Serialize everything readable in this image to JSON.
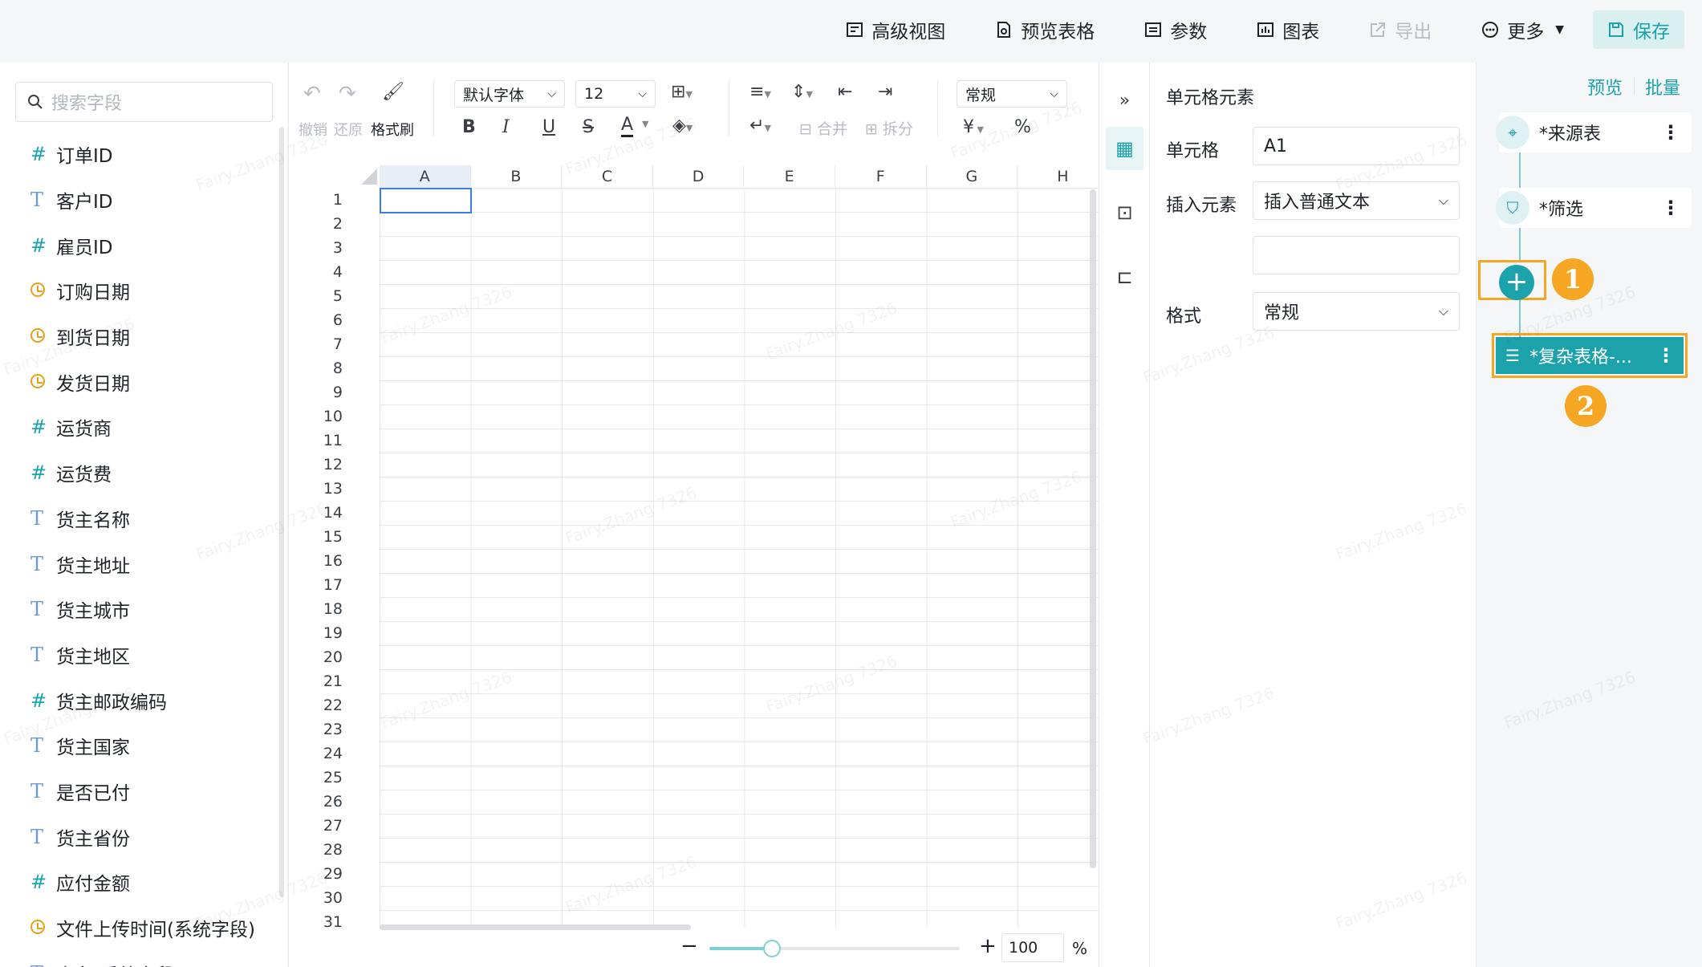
{
  "topbar": {
    "items": [
      {
        "label": "高级视图",
        "icon": "advanced-view-icon"
      },
      {
        "label": "预览表格",
        "icon": "preview-table-icon"
      },
      {
        "label": "参数",
        "icon": "parameter-icon"
      },
      {
        "label": "图表",
        "icon": "chart-icon"
      },
      {
        "label": "导出",
        "icon": "export-icon"
      },
      {
        "label": "更多",
        "icon": "more-icon"
      }
    ],
    "save_label": "保存"
  },
  "field_panel": {
    "search_placeholder": "搜索字段",
    "fields": [
      {
        "type": "#",
        "label": "订单ID"
      },
      {
        "type": "T",
        "label": "客户ID"
      },
      {
        "type": "#",
        "label": "雇员ID"
      },
      {
        "type": "clock",
        "label": "订购日期"
      },
      {
        "type": "clock",
        "label": "到货日期"
      },
      {
        "type": "clock",
        "label": "发货日期"
      },
      {
        "type": "#",
        "label": "运货商"
      },
      {
        "type": "#",
        "label": "运货费"
      },
      {
        "type": "T",
        "label": "货主名称"
      },
      {
        "type": "T",
        "label": "货主地址"
      },
      {
        "type": "T",
        "label": "货主城市"
      },
      {
        "type": "T",
        "label": "货主地区"
      },
      {
        "type": "#",
        "label": "货主邮政编码"
      },
      {
        "type": "T",
        "label": "货主国家"
      },
      {
        "type": "T",
        "label": "是否已付"
      },
      {
        "type": "T",
        "label": "货主省份"
      },
      {
        "type": "#",
        "label": "应付金额"
      },
      {
        "type": "clock",
        "label": "文件上传时间(系统字段)"
      },
      {
        "type": "T",
        "label": "表名(系统字段)"
      }
    ]
  },
  "toolbar": {
    "undo": "撤销",
    "redo": "还原",
    "format_painter": "格式刷",
    "font": "默认字体",
    "font_size": "12",
    "merge": "合并",
    "split": "拆分",
    "number_format": "常规",
    "currency": "¥",
    "percent": "%",
    "bold": "B",
    "italic": "I",
    "underline": "U",
    "strike": "S",
    "font_color": "A"
  },
  "grid": {
    "columns": [
      "A",
      "B",
      "C",
      "D",
      "E",
      "F",
      "G",
      "H"
    ],
    "rows": [
      "1",
      "2",
      "3",
      "4",
      "5",
      "6",
      "7",
      "8",
      "9",
      "10",
      "11",
      "12",
      "13",
      "14",
      "15",
      "16",
      "17",
      "18",
      "19",
      "20",
      "21",
      "22",
      "23",
      "24",
      "25",
      "26",
      "27",
      "28",
      "29",
      "30",
      "31"
    ],
    "selected_cell": "A1"
  },
  "zoom": {
    "value": "100",
    "unit": "%",
    "minus": "−",
    "plus": "+",
    "level": 0.25
  },
  "props": {
    "title": "单元格元素",
    "cell_label": "单元格",
    "cell_value": "A1",
    "insert_label": "插入元素",
    "insert_value": "插入普通文本",
    "format_label": "格式",
    "format_value": "常规"
  },
  "flow": {
    "preview": "预览",
    "batch": "批量",
    "source_node": "*来源表",
    "filter_node": "*筛选",
    "complex_node": "*复杂表格-...",
    "badge1": "1",
    "badge2": "2"
  },
  "watermark": "Fairy.Zhang 7326",
  "colors": {
    "accent": "#1ba2ab",
    "highlight": "#f5a623",
    "selection": "#3d7de6"
  }
}
